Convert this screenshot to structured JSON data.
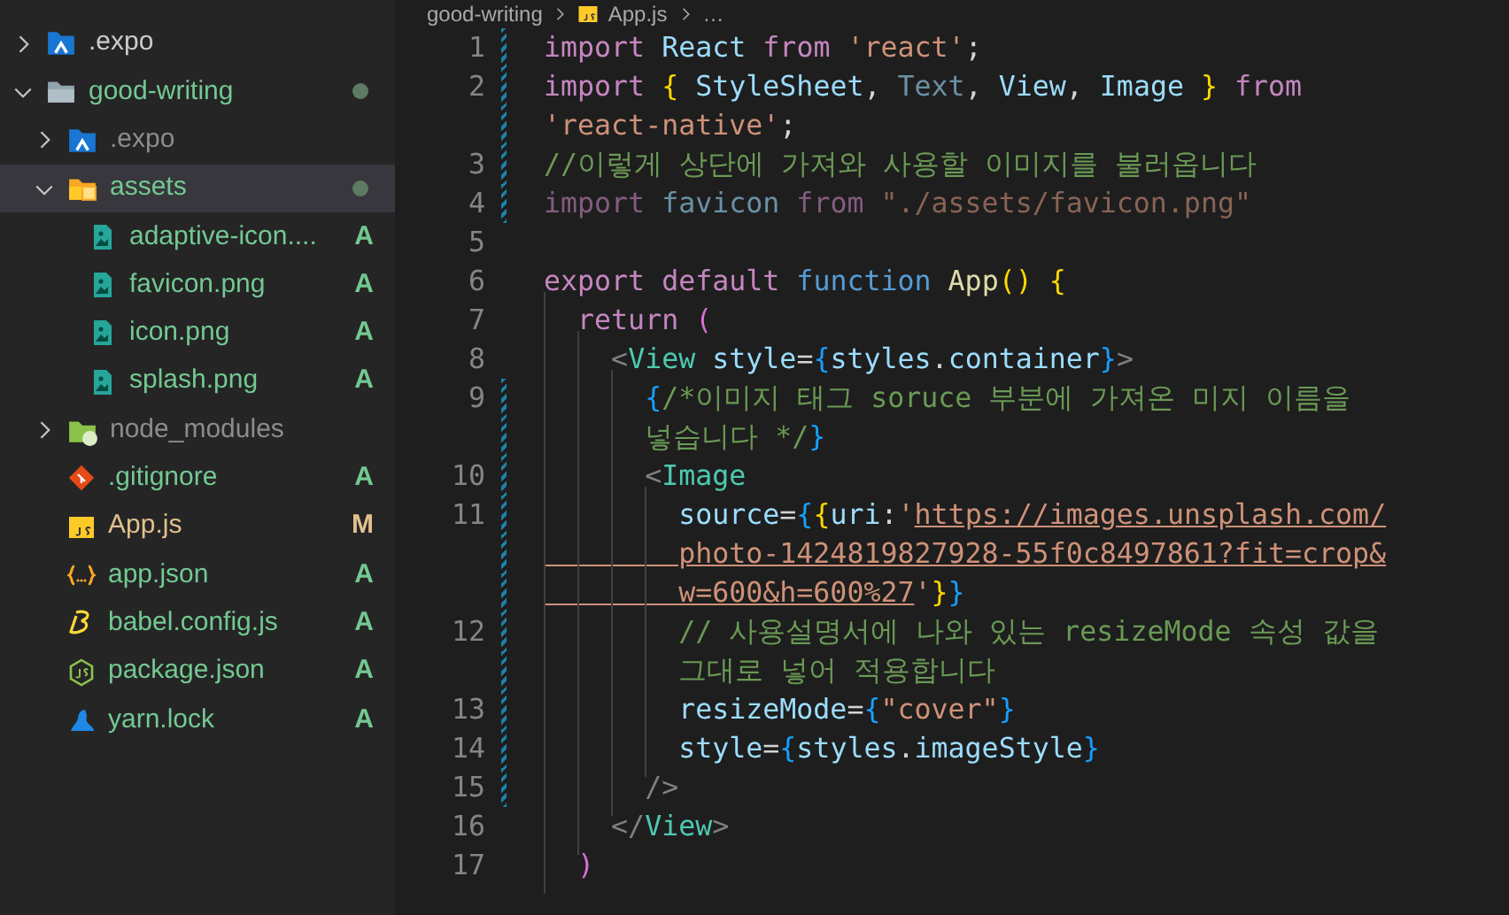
{
  "breadcrumb": [
    {
      "kind": "folder",
      "text": "good-writing"
    },
    {
      "kind": "js",
      "text": "App.js"
    },
    {
      "kind": "more",
      "text": "…"
    }
  ],
  "explorer": [
    {
      "label": ".expo",
      "kind": "expo-folder",
      "expanded": false,
      "ignored": false,
      "dot": false
    },
    {
      "label": "good-writing",
      "kind": "folder",
      "expanded": true,
      "ignored": false,
      "dot": true,
      "children": [
        {
          "label": ".expo",
          "kind": "expo-folder",
          "expanded": false,
          "ignored": true,
          "dot": false
        },
        {
          "label": "assets",
          "kind": "assets-folder",
          "expanded": true,
          "selected": true,
          "ignored": false,
          "dot": true,
          "children": [
            {
              "label": "adaptive-icon....",
              "kind": "image",
              "badge": "A",
              "ignored": false,
              "dot": false,
              "selected": false
            },
            {
              "label": "favicon.png",
              "kind": "image",
              "badge": "A",
              "ignored": false,
              "dot": false,
              "selected": false
            },
            {
              "label": "icon.png",
              "kind": "image",
              "badge": "A",
              "ignored": false,
              "dot": false,
              "selected": false
            },
            {
              "label": "splash.png",
              "kind": "image",
              "badge": "A",
              "ignored": false,
              "dot": false,
              "selected": false
            }
          ]
        },
        {
          "label": "node_modules",
          "kind": "node-folder",
          "expanded": false,
          "ignored": true,
          "dot": false,
          "selected": false
        },
        {
          "label": ".gitignore",
          "kind": "git",
          "badge": "A",
          "ignored": false,
          "dot": false,
          "selected": false
        },
        {
          "label": "App.js",
          "kind": "js",
          "badge": "M",
          "ignored": false,
          "dot": false,
          "selected": false
        },
        {
          "label": "app.json",
          "kind": "json",
          "badge": "A",
          "ignored": false,
          "dot": false,
          "selected": false
        },
        {
          "label": "babel.config.js",
          "kind": "babel",
          "badge": "A",
          "ignored": false,
          "dot": false,
          "selected": false
        },
        {
          "label": "package.json",
          "kind": "node",
          "badge": "A",
          "ignored": false,
          "dot": false,
          "selected": false
        },
        {
          "label": "yarn.lock",
          "kind": "yarn",
          "badge": "A",
          "ignored": false,
          "dot": false,
          "selected": false
        }
      ]
    }
  ],
  "code_lines": [
    {
      "number": "1",
      "modified": true,
      "rows": [
        {
          "segments": [
            {
              "kind": "keyword",
              "text": "import"
            },
            {
              "kind": "variable",
              "text": " React"
            },
            {
              "kind": "keyword",
              "text": " from"
            },
            {
              "kind": "string",
              "text": " 'react'"
            },
            {
              "kind": "plain",
              "text": ";"
            }
          ]
        }
      ]
    },
    {
      "number": "2",
      "modified": true,
      "rows": [
        {
          "segments": [
            {
              "kind": "keyword",
              "text": "import"
            },
            {
              "kind": "gold",
              "text": " {"
            },
            {
              "kind": "variable",
              "text": " StyleSheet"
            },
            {
              "kind": "plain",
              "text": ","
            },
            {
              "kind": "dimvariable",
              "text": " Text"
            },
            {
              "kind": "plain",
              "text": ","
            },
            {
              "kind": "variable",
              "text": " View"
            },
            {
              "kind": "plain",
              "text": ","
            },
            {
              "kind": "variable",
              "text": " Image"
            },
            {
              "kind": "gold",
              "text": " }"
            },
            {
              "kind": "keyword",
              "text": " from"
            }
          ]
        },
        {
          "segments": [
            {
              "kind": "string",
              "text": "'react-native'"
            },
            {
              "kind": "plain",
              "text": ";"
            }
          ]
        }
      ]
    },
    {
      "number": "3",
      "modified": true,
      "rows": [
        {
          "segments": [
            {
              "kind": "comment",
              "text": "//이렇게 상단에 가져와 사용할 이미지를 불러옵니다"
            }
          ]
        }
      ]
    },
    {
      "number": "4",
      "modified": true,
      "rows": [
        {
          "segments": [
            {
              "kind": "dimkeyword",
              "text": "import"
            },
            {
              "kind": "dimvariable",
              "text": " favicon"
            },
            {
              "kind": "dimkeyword",
              "text": " from"
            },
            {
              "kind": "dimstring",
              "text": " \"./assets/favicon.png\""
            }
          ]
        }
      ]
    },
    {
      "number": "5",
      "modified": false,
      "rows": [
        {
          "segments": []
        }
      ]
    },
    {
      "number": "6",
      "modified": false,
      "rows": [
        {
          "segments": [
            {
              "kind": "keyword",
              "text": "export"
            },
            {
              "kind": "keyword",
              "text": " default"
            },
            {
              "kind": "storage",
              "text": " function"
            },
            {
              "kind": "function",
              "text": " App"
            },
            {
              "kind": "gold",
              "text": "()"
            },
            {
              "kind": "gold",
              "text": " {"
            }
          ]
        }
      ]
    },
    {
      "number": "7",
      "modified": false,
      "rows": [
        {
          "segments": [
            {
              "kind": "keyword",
              "text": "  return"
            },
            {
              "kind": "pink",
              "text": " ("
            }
          ]
        }
      ]
    },
    {
      "number": "8",
      "modified": false,
      "rows": [
        {
          "segments": [
            {
              "kind": "angle",
              "text": "    <"
            },
            {
              "kind": "tag",
              "text": "View"
            },
            {
              "kind": "variable",
              "text": " style"
            },
            {
              "kind": "plain",
              "text": "="
            },
            {
              "kind": "blue",
              "text": "{"
            },
            {
              "kind": "variable",
              "text": "styles"
            },
            {
              "kind": "plain",
              "text": "."
            },
            {
              "kind": "variable",
              "text": "container"
            },
            {
              "kind": "blue",
              "text": "}"
            },
            {
              "kind": "angle",
              "text": ">"
            }
          ]
        }
      ]
    },
    {
      "number": "9",
      "modified": true,
      "rows": [
        {
          "segments": [
            {
              "kind": "blue",
              "text": "      {"
            },
            {
              "kind": "comment",
              "text": "/*이미지 태그 soruce 부분에 가져온 미지 이름을"
            }
          ]
        },
        {
          "segments": [
            {
              "kind": "comment",
              "text": "      넣습니다 */"
            },
            {
              "kind": "blue",
              "text": "}"
            }
          ]
        }
      ]
    },
    {
      "number": "10",
      "modified": true,
      "rows": [
        {
          "segments": [
            {
              "kind": "angle",
              "text": "      <"
            },
            {
              "kind": "tag",
              "text": "Image"
            }
          ]
        }
      ]
    },
    {
      "number": "11",
      "modified": true,
      "rows": [
        {
          "segments": [
            {
              "kind": "variable",
              "text": "        source"
            },
            {
              "kind": "plain",
              "text": "="
            },
            {
              "kind": "blue",
              "text": "{"
            },
            {
              "kind": "gold",
              "text": "{"
            },
            {
              "kind": "variable",
              "text": "uri"
            },
            {
              "kind": "plain",
              "text": ":"
            },
            {
              "kind": "string",
              "text": "'"
            },
            {
              "kind": "link",
              "text": "https://images.unsplash.com/"
            }
          ]
        },
        {
          "segments": [
            {
              "kind": "link",
              "text": "        photo-1424819827928-55f0c8497861?fit=crop&"
            }
          ]
        },
        {
          "segments": [
            {
              "kind": "link",
              "text": "        w=600&h=600%27"
            },
            {
              "kind": "string",
              "text": "'"
            },
            {
              "kind": "gold",
              "text": "}"
            },
            {
              "kind": "blue",
              "text": "}"
            }
          ]
        }
      ]
    },
    {
      "number": "12",
      "modified": true,
      "rows": [
        {
          "segments": [
            {
              "kind": "comment",
              "text": "        // 사용설명서에 나와 있는 resizeMode 속성 값을"
            }
          ]
        },
        {
          "segments": [
            {
              "kind": "comment",
              "text": "        그대로 넣어 적용합니다"
            }
          ]
        }
      ]
    },
    {
      "number": "13",
      "modified": true,
      "rows": [
        {
          "segments": [
            {
              "kind": "variable",
              "text": "        resizeMode"
            },
            {
              "kind": "plain",
              "text": "="
            },
            {
              "kind": "blue",
              "text": "{"
            },
            {
              "kind": "string",
              "text": "\"cover\""
            },
            {
              "kind": "blue",
              "text": "}"
            }
          ]
        }
      ]
    },
    {
      "number": "14",
      "modified": true,
      "rows": [
        {
          "segments": [
            {
              "kind": "variable",
              "text": "        style"
            },
            {
              "kind": "plain",
              "text": "="
            },
            {
              "kind": "blue",
              "text": "{"
            },
            {
              "kind": "variable",
              "text": "styles"
            },
            {
              "kind": "plain",
              "text": "."
            },
            {
              "kind": "variable",
              "text": "imageStyle"
            },
            {
              "kind": "blue",
              "text": "}"
            }
          ]
        }
      ]
    },
    {
      "number": "15",
      "modified": true,
      "rows": [
        {
          "segments": [
            {
              "kind": "angle",
              "text": "      />"
            }
          ]
        }
      ]
    },
    {
      "number": "16",
      "modified": false,
      "rows": [
        {
          "segments": [
            {
              "kind": "angle",
              "text": "    </"
            },
            {
              "kind": "tag",
              "text": "View"
            },
            {
              "kind": "angle",
              "text": ">"
            }
          ]
        }
      ]
    },
    {
      "number": "17",
      "modified": false,
      "rows": [
        {
          "segments": [
            {
              "kind": "pink",
              "text": "  )"
            }
          ]
        }
      ]
    }
  ]
}
